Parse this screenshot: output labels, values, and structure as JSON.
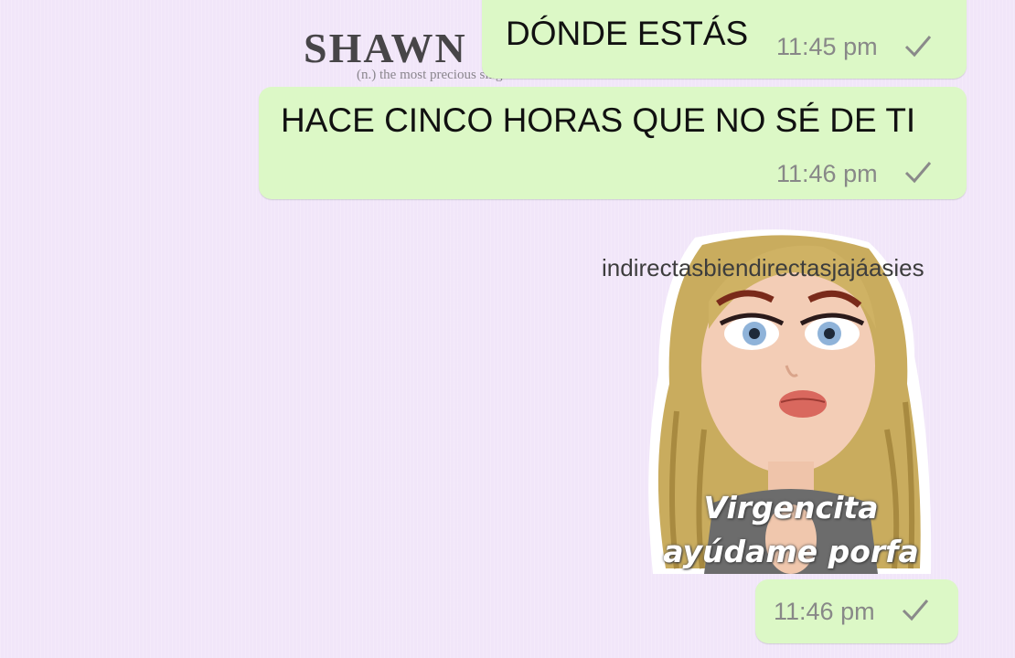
{
  "wallpaper": {
    "title": "SHAWN",
    "subtitle": "(n.) the most precious singer that ..."
  },
  "messages": [
    {
      "text": "DÓNDE ESTÁS",
      "time": "11:45 pm",
      "status_icon": "single-check-icon"
    },
    {
      "text": "HACE CINCO HORAS QUE NO SÉ DE TI",
      "time": "11:46 pm",
      "status_icon": "single-check-icon"
    },
    {
      "sticker_caption_line1": "Virgencita",
      "sticker_caption_line2": "ayúdame porfa",
      "time": "11:46 pm",
      "status_icon": "single-check-icon"
    }
  ],
  "watermark": "indirectasbiendirectasjajáasies",
  "colors": {
    "background": "#f1e6f9",
    "outgoing_bubble": "#dcf8c6",
    "timestamp": "#888888"
  }
}
